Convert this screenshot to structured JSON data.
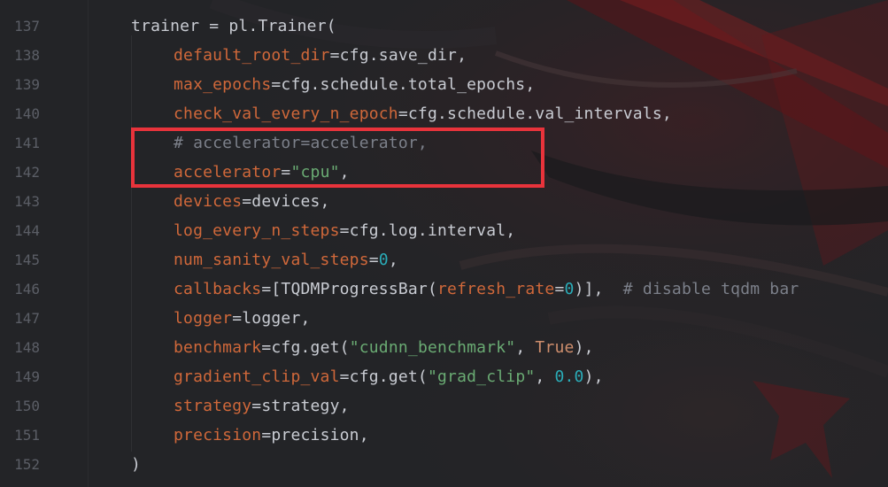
{
  "editor": {
    "line_numbers": [
      "137",
      "138",
      "139",
      "140",
      "141",
      "142",
      "143",
      "144",
      "145",
      "146",
      "147",
      "148",
      "149",
      "150",
      "151",
      "152"
    ],
    "code_lines": [
      [
        {
          "text": "trainer = pl.Trainer(",
          "role": "plain"
        }
      ],
      [
        {
          "text": "default_root_dir",
          "role": "param"
        },
        {
          "text": "=cfg.save_dir,",
          "role": "plain"
        }
      ],
      [
        {
          "text": "max_epochs",
          "role": "param"
        },
        {
          "text": "=cfg.schedule.total_epochs,",
          "role": "plain"
        }
      ],
      [
        {
          "text": "check_val_every_n_epoch",
          "role": "param"
        },
        {
          "text": "=cfg.schedule.val_intervals,",
          "role": "plain"
        }
      ],
      [
        {
          "text": "# accelerator=accelerator,",
          "role": "comment"
        }
      ],
      [
        {
          "text": "accelerator",
          "role": "param"
        },
        {
          "text": "=",
          "role": "plain"
        },
        {
          "text": "\"cpu\"",
          "role": "string"
        },
        {
          "text": ",",
          "role": "plain"
        }
      ],
      [
        {
          "text": "devices",
          "role": "param"
        },
        {
          "text": "=devices,",
          "role": "plain"
        }
      ],
      [
        {
          "text": "log_every_n_steps",
          "role": "param"
        },
        {
          "text": "=cfg.log.interval,",
          "role": "plain"
        }
      ],
      [
        {
          "text": "num_sanity_val_steps",
          "role": "param"
        },
        {
          "text": "=",
          "role": "plain"
        },
        {
          "text": "0",
          "role": "number"
        },
        {
          "text": ",",
          "role": "plain"
        }
      ],
      [
        {
          "text": "callbacks",
          "role": "param"
        },
        {
          "text": "=[TQDMProgressBar(",
          "role": "plain"
        },
        {
          "text": "refresh_rate",
          "role": "param"
        },
        {
          "text": "=",
          "role": "plain"
        },
        {
          "text": "0",
          "role": "number"
        },
        {
          "text": ")],  ",
          "role": "plain"
        },
        {
          "text": "# disable tqdm bar",
          "role": "comment"
        }
      ],
      [
        {
          "text": "logger",
          "role": "param"
        },
        {
          "text": "=logger,",
          "role": "plain"
        }
      ],
      [
        {
          "text": "benchmark",
          "role": "param"
        },
        {
          "text": "=cfg.get(",
          "role": "plain"
        },
        {
          "text": "\"cudnn_benchmark\"",
          "role": "string"
        },
        {
          "text": ", ",
          "role": "plain"
        },
        {
          "text": "True",
          "role": "keyword"
        },
        {
          "text": "),",
          "role": "plain"
        }
      ],
      [
        {
          "text": "gradient_clip_val",
          "role": "param"
        },
        {
          "text": "=cfg.get(",
          "role": "plain"
        },
        {
          "text": "\"grad_clip\"",
          "role": "string"
        },
        {
          "text": ", ",
          "role": "plain"
        },
        {
          "text": "0.0",
          "role": "number"
        },
        {
          "text": "),",
          "role": "plain"
        }
      ],
      [
        {
          "text": "strategy",
          "role": "param"
        },
        {
          "text": "=strategy,",
          "role": "plain"
        }
      ],
      [
        {
          "text": "precision",
          "role": "param"
        },
        {
          "text": "=precision,",
          "role": "plain"
        }
      ],
      [
        {
          "text": ")",
          "role": "plain"
        }
      ]
    ]
  },
  "theme": {
    "plain": "#c9ccd3",
    "param": "#d0683a",
    "comment": "#7c808a",
    "string": "#6aab73",
    "number": "#2aacb8",
    "keyword": "#cf8e6d",
    "line_number": "#5b5e66",
    "highlight_border": "#e8333b",
    "background": "#232427"
  }
}
